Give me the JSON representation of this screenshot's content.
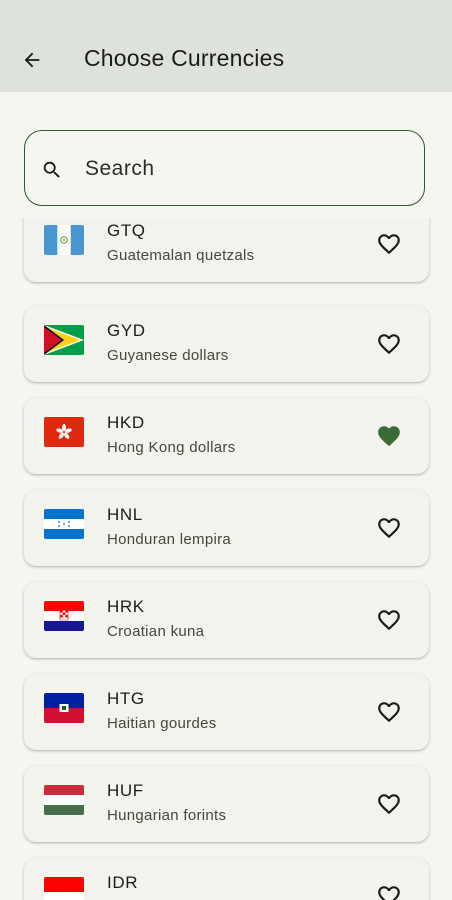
{
  "header": {
    "title": "Choose Currencies",
    "back_icon": "arrow-back-icon"
  },
  "search": {
    "placeholder": "Search",
    "value": "",
    "icon": "search-icon"
  },
  "colors": {
    "accent": "#2f5a2c",
    "favorite_filled": "#3a6a35",
    "appbar": "#dde3da",
    "background": "#f4f6ef"
  },
  "currencies": [
    {
      "code": "GTQ",
      "name": "Guatemalan quetzals",
      "flag": "flag-guatemala-icon",
      "favorite": false
    },
    {
      "code": "GYD",
      "name": "Guyanese dollars",
      "flag": "flag-guyana-icon",
      "favorite": false
    },
    {
      "code": "HKD",
      "name": "Hong Kong dollars",
      "flag": "flag-hong-kong-icon",
      "favorite": true
    },
    {
      "code": "HNL",
      "name": "Honduran lempira",
      "flag": "flag-honduras-icon",
      "favorite": false
    },
    {
      "code": "HRK",
      "name": "Croatian kuna",
      "flag": "flag-croatia-icon",
      "favorite": false
    },
    {
      "code": "HTG",
      "name": "Haitian gourdes",
      "flag": "flag-haiti-icon",
      "favorite": false
    },
    {
      "code": "HUF",
      "name": "Hungarian forints",
      "flag": "flag-hungary-icon",
      "favorite": false
    },
    {
      "code": "IDR",
      "name": "",
      "flag": "flag-indonesia-icon",
      "favorite": false
    }
  ]
}
